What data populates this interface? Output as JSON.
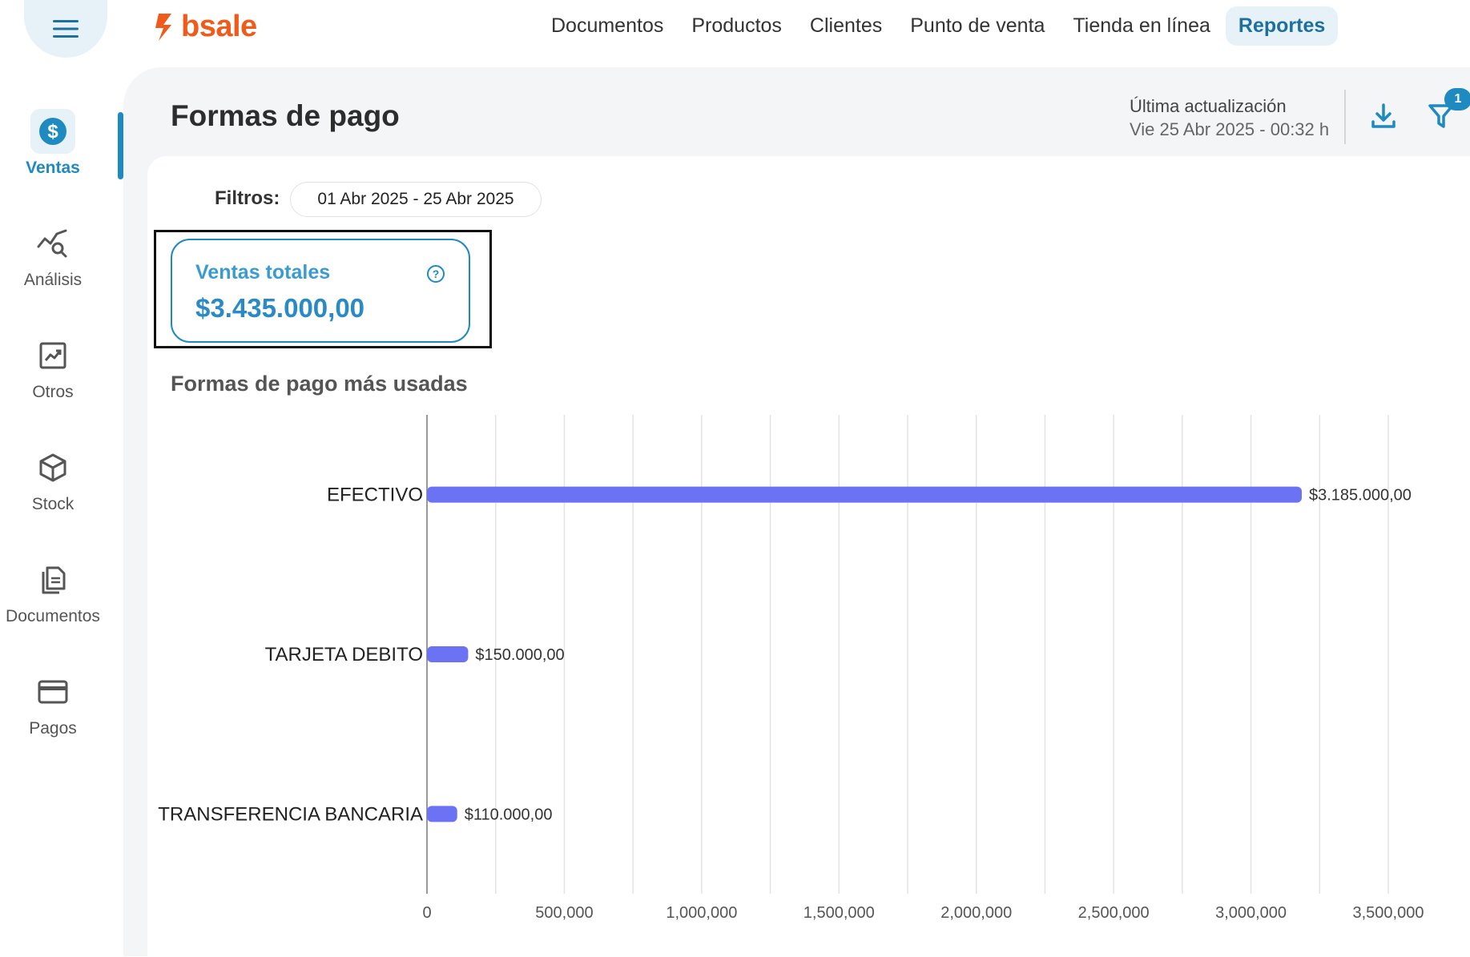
{
  "header": {
    "brand": "bsale",
    "nav": [
      "Documentos",
      "Productos",
      "Clientes",
      "Punto de venta",
      "Tienda en línea",
      "Reportes"
    ],
    "active_nav": "Reportes"
  },
  "sidebar": {
    "items": [
      {
        "label": "Ventas",
        "icon": "dollar-icon"
      },
      {
        "label": "Análisis",
        "icon": "analysis-icon"
      },
      {
        "label": "Otros",
        "icon": "trend-chart-icon"
      },
      {
        "label": "Stock",
        "icon": "box-icon"
      },
      {
        "label": "Documentos",
        "icon": "documents-icon"
      },
      {
        "label": "Pagos",
        "icon": "credit-card-icon"
      }
    ],
    "active": "Ventas"
  },
  "page": {
    "title": "Formas de pago",
    "update_label": "Última actualización",
    "update_date": "Vie 25 Abr 2025 - 00:32 h",
    "filter_badge": "1"
  },
  "filters": {
    "label": "Filtros:",
    "date_range": "01 Abr 2025 - 25 Abr 2025"
  },
  "kpi": {
    "label": "Ventas totales",
    "value": "$3.435.000,00"
  },
  "section": {
    "title": "Formas de pago más usadas"
  },
  "colors": {
    "accent": "#1f8ac0",
    "bar": "#6b72f3",
    "brand": "#f05a1a"
  },
  "chart_data": {
    "type": "bar",
    "orientation": "horizontal",
    "categories": [
      "EFECTIVO",
      "TARJETA DEBITO",
      "TRANSFERENCIA BANCARIA"
    ],
    "values": [
      3185000,
      150000,
      110000
    ],
    "value_labels": [
      "$3.185.000,00",
      "$150.000,00",
      "$110.000,00"
    ],
    "xlim": [
      0,
      3500000
    ],
    "xticks": [
      0,
      500000,
      1000000,
      1500000,
      2000000,
      2500000,
      3000000,
      3500000
    ],
    "xtick_labels": [
      "0",
      "500,000",
      "1,000,000",
      "1,500,000",
      "2,000,000",
      "2,500,000",
      "3,000,000",
      "3,500,000"
    ],
    "grid": true
  }
}
